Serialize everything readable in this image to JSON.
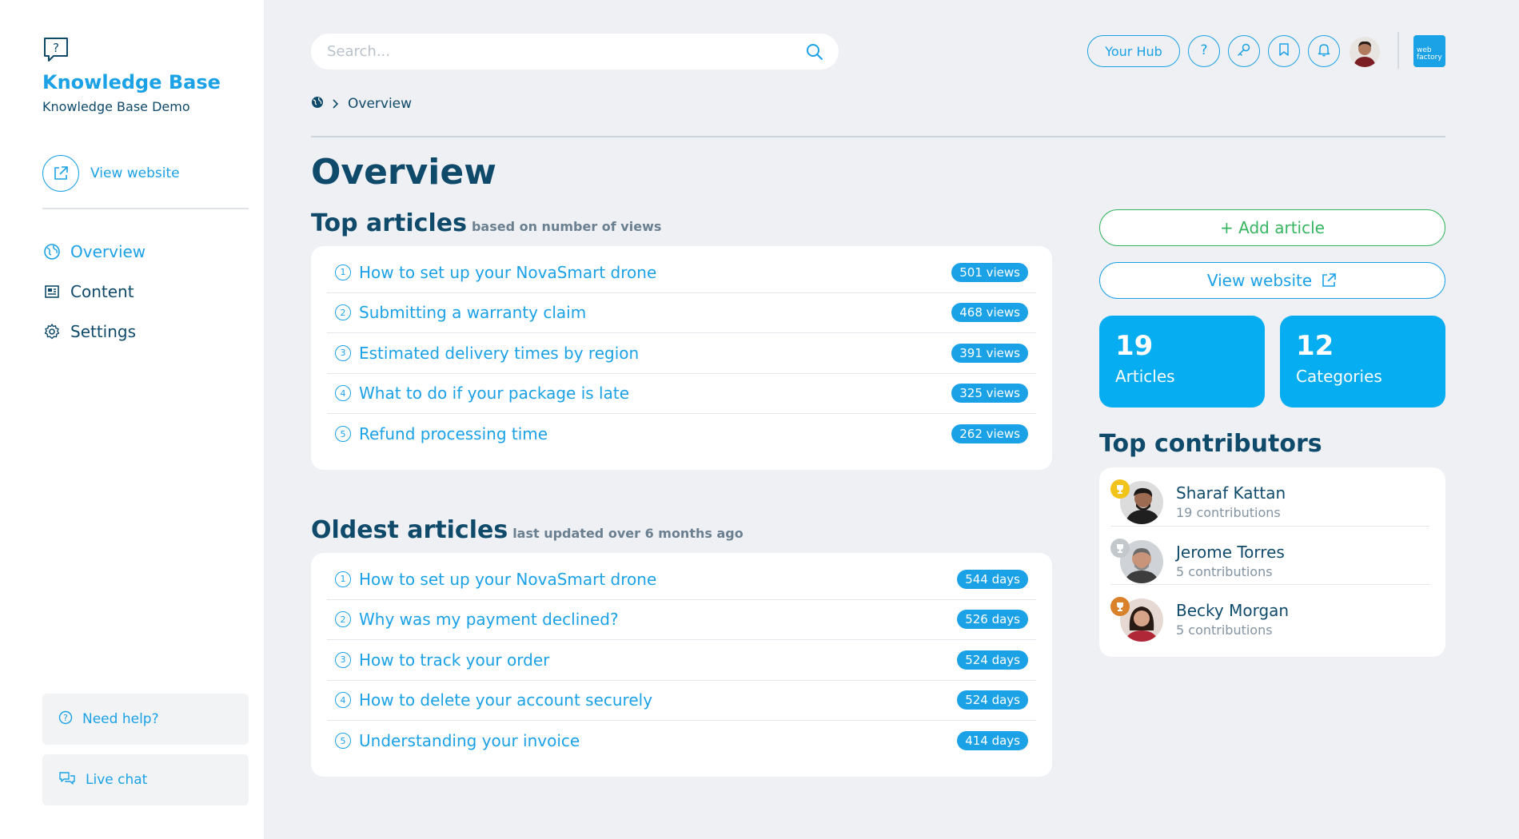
{
  "brand": {
    "title": "Knowledge Base",
    "subtitle": "Knowledge Base Demo",
    "icon": "question-chat-icon"
  },
  "sidebar": {
    "view_website": "View website",
    "nav": [
      {
        "label": "Overview",
        "icon": "globe-icon",
        "active": true
      },
      {
        "label": "Content",
        "icon": "newspaper-icon",
        "active": false
      },
      {
        "label": "Settings",
        "icon": "gear-icon",
        "active": false
      }
    ],
    "need_help": "Need help?",
    "live_chat": "Live chat"
  },
  "header": {
    "search_placeholder": "Search...",
    "hub_label": "Your Hub",
    "icons": [
      "help-icon",
      "key-icon",
      "bookmark-icon",
      "bell-icon"
    ],
    "brand_badge": "web factory"
  },
  "breadcrumb": {
    "current": "Overview"
  },
  "page": {
    "title": "Overview"
  },
  "top_articles": {
    "title": "Top articles",
    "subtitle": "based on number of views",
    "items": [
      {
        "n": "1",
        "title": "How to set up your NovaSmart drone",
        "value": "501 views"
      },
      {
        "n": "2",
        "title": "Submitting a warranty claim",
        "value": "468 views"
      },
      {
        "n": "3",
        "title": "Estimated delivery times by region",
        "value": "391 views"
      },
      {
        "n": "4",
        "title": "What to do if your package is late",
        "value": "325 views"
      },
      {
        "n": "5",
        "title": "Refund processing time",
        "value": "262 views"
      }
    ]
  },
  "oldest_articles": {
    "title": "Oldest articles",
    "subtitle": "last updated over 6 months ago",
    "items": [
      {
        "n": "1",
        "title": "How to set up your NovaSmart drone",
        "value": "544 days"
      },
      {
        "n": "2",
        "title": "Why was my payment declined?",
        "value": "526 days"
      },
      {
        "n": "3",
        "title": "How to track your order",
        "value": "524 days"
      },
      {
        "n": "4",
        "title": "How to delete your account securely",
        "value": "524 days"
      },
      {
        "n": "5",
        "title": "Understanding your invoice",
        "value": "414 days"
      }
    ]
  },
  "actions": {
    "add_article": "+ Add article",
    "view_website": "View website"
  },
  "stats": [
    {
      "value": "19",
      "label": "Articles"
    },
    {
      "value": "12",
      "label": "Categories"
    }
  ],
  "contributors": {
    "title": "Top contributors",
    "items": [
      {
        "name": "Sharaf Kattan",
        "count": "19 contributions",
        "trophy_color": "#f2c318"
      },
      {
        "name": "Jerome Torres",
        "count": "5 contributions",
        "trophy_color": "#c3c8cd"
      },
      {
        "name": "Becky Morgan",
        "count": "5 contributions",
        "trophy_color": "#d9822b"
      }
    ]
  },
  "colors": {
    "accent": "#1aa1e6",
    "dark": "#0f4a6b",
    "green": "#36b560",
    "stat_bg": "#06adf0"
  }
}
